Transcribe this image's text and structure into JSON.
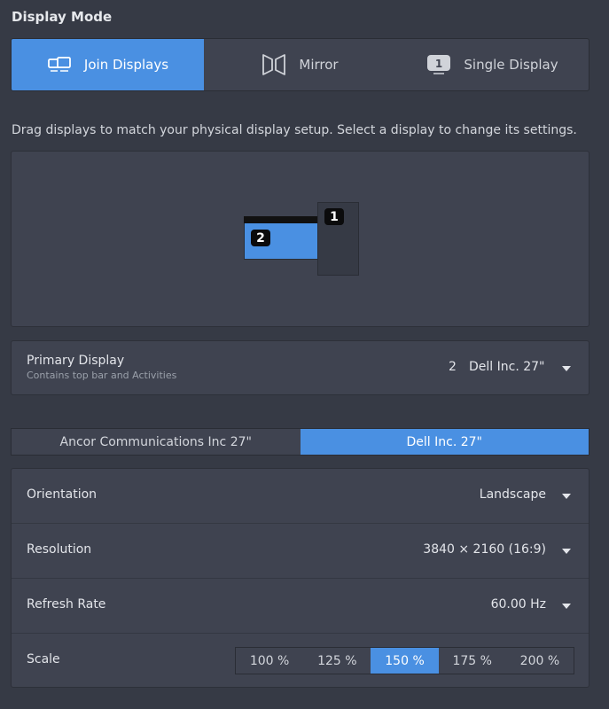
{
  "section_title": "Display Mode",
  "modes": [
    {
      "label": "Join Displays",
      "icon": "join-displays-icon",
      "active": true
    },
    {
      "label": "Mirror",
      "icon": "mirror-icon",
      "active": false
    },
    {
      "label": "Single Display",
      "icon": "single-display-icon",
      "active": false
    }
  ],
  "hint": "Drag displays to match your physical display setup. Select a display to change its settings.",
  "arrangement": {
    "monitor_1_number": "1",
    "monitor_2_number": "2"
  },
  "primary_display": {
    "label": "Primary Display",
    "sublabel": "Contains top bar and Activities",
    "number": "2",
    "name": "Dell Inc. 27\""
  },
  "monitor_tabs": [
    {
      "label": "Ancor Communications Inc 27\"",
      "active": false
    },
    {
      "label": "Dell Inc. 27\"",
      "active": true
    }
  ],
  "settings": {
    "orientation": {
      "label": "Orientation",
      "value": "Landscape"
    },
    "resolution": {
      "label": "Resolution",
      "value": "3840 × 2160 (16:9)"
    },
    "refresh_rate": {
      "label": "Refresh Rate",
      "value": "60.00 Hz"
    },
    "scale": {
      "label": "Scale",
      "options": [
        "100 %",
        "125 %",
        "150 %",
        "175 %",
        "200 %"
      ],
      "selected": "150 %"
    }
  },
  "colors": {
    "accent": "#4a90e2",
    "background": "#363a45",
    "panel": "#3f4350"
  }
}
